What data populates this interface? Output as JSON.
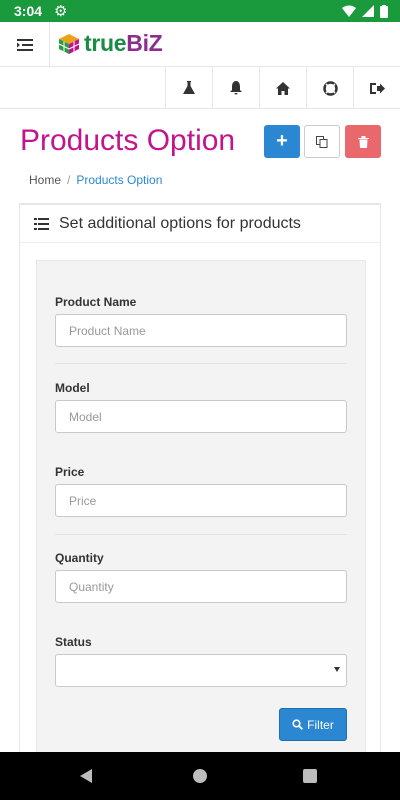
{
  "status_bar": {
    "time": "3:04"
  },
  "header": {
    "brand_part1": "true",
    "brand_part2": "BiZ"
  },
  "icon_bar": [
    "flask-icon",
    "bell-icon",
    "home-icon",
    "lifebuoy-icon",
    "logout-icon"
  ],
  "page": {
    "title": "Products Option",
    "breadcrumb": {
      "home": "Home",
      "current": "Products Option"
    }
  },
  "portlet": {
    "caption": "Set additional options for products"
  },
  "form": {
    "product_name": {
      "label": "Product Name",
      "placeholder": "Product Name"
    },
    "model": {
      "label": "Model",
      "placeholder": "Model"
    },
    "price": {
      "label": "Price",
      "placeholder": "Price"
    },
    "quantity": {
      "label": "Quantity",
      "placeholder": "Quantity"
    },
    "status": {
      "label": "Status",
      "value": ""
    },
    "filter_button": "Filter"
  },
  "colors": {
    "status_bar": "#1a9a3c",
    "title": "#c2148c",
    "primary": "#2b87d1",
    "danger": "#e9686c"
  }
}
